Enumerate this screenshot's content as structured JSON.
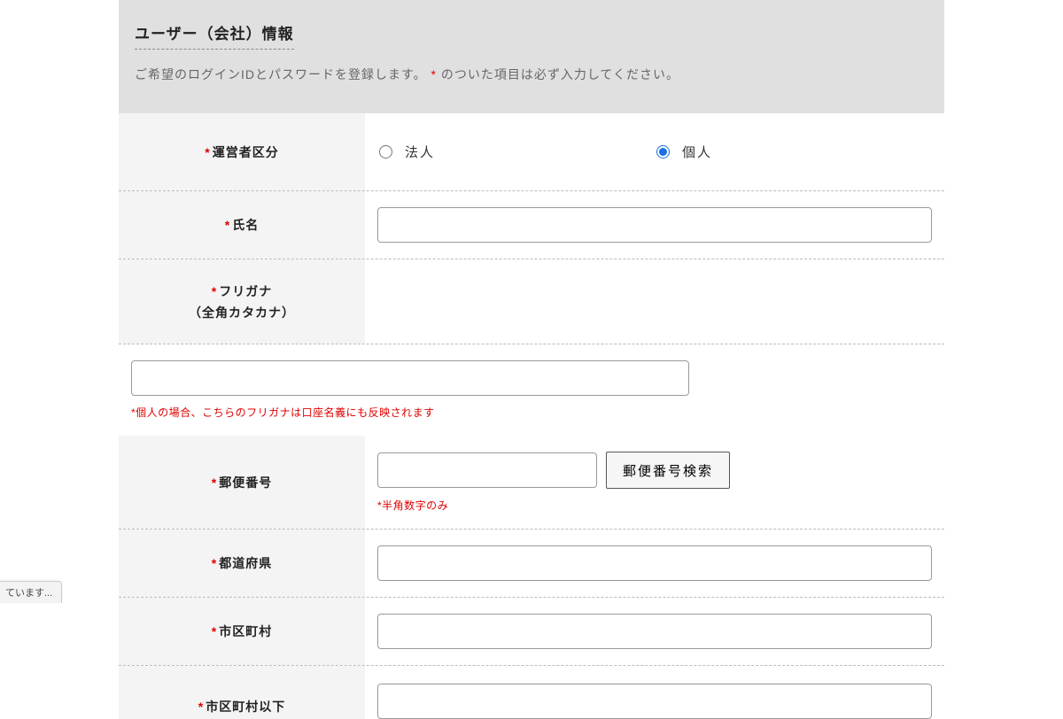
{
  "header": {
    "title": "ユーザー（会社）情報",
    "description_pre": "ご希望のログインIDとパスワードを登録します。",
    "description_mark": "*",
    "description_post": "のついた項目は必ず入力してください。"
  },
  "required_mark": "*",
  "fields": {
    "operator_type": {
      "label": "運営者区分",
      "option_corporate": "法人",
      "option_individual": "個人",
      "selected": "individual"
    },
    "name": {
      "label": "氏名",
      "value": ""
    },
    "furigana": {
      "label": "フリガナ",
      "sublabel": "（全角カタカナ）",
      "value": "",
      "helper": "*個人の場合、こちらのフリガナは口座名義にも反映されます"
    },
    "postal": {
      "label": "郵便番号",
      "value": "",
      "search_button": "郵便番号検索",
      "helper": "*半角数字のみ"
    },
    "prefecture": {
      "label": "都道府県",
      "value": ""
    },
    "city": {
      "label": "市区町村",
      "value": ""
    },
    "address_rest": {
      "label": "市区町村以下",
      "value": ""
    }
  },
  "statusbar": {
    "text": "ています..."
  }
}
